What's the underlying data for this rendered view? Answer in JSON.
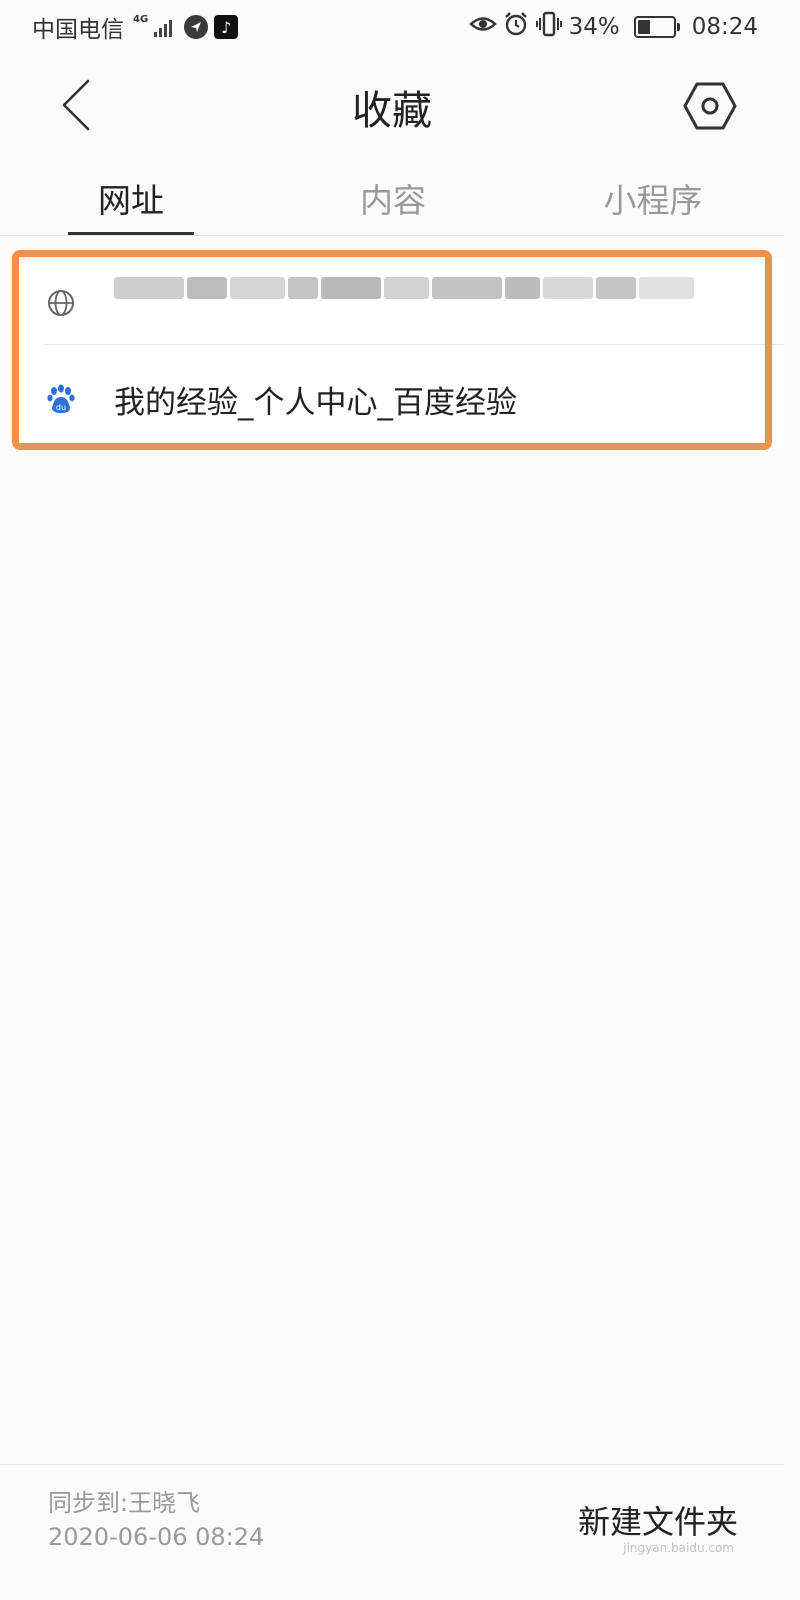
{
  "status_bar": {
    "carrier": "中国电信",
    "network": "4G",
    "battery_percent": "34%",
    "battery_level": 0.34,
    "time": "08:24"
  },
  "header": {
    "title": "收藏",
    "back_icon": "chevron-left-icon",
    "settings_icon": "hexagon-settings-icon"
  },
  "tabs": [
    {
      "label": "网址",
      "active": true
    },
    {
      "label": "内容",
      "active": false
    },
    {
      "label": "小程序",
      "active": false
    }
  ],
  "bookmarks": [
    {
      "icon": "globe-icon",
      "title": ""
    },
    {
      "icon": "baidu-paw-icon",
      "title": "我的经验_个人中心_百度经验"
    }
  ],
  "footer": {
    "sync_label": "同步到:王晓飞",
    "sync_time": "2020-06-06 08:24",
    "new_folder_label": "新建文件夹"
  },
  "watermark": "jingyan.baidu.com",
  "colors": {
    "highlight": "#f0924a",
    "baidu_blue": "#2f6fd9"
  }
}
